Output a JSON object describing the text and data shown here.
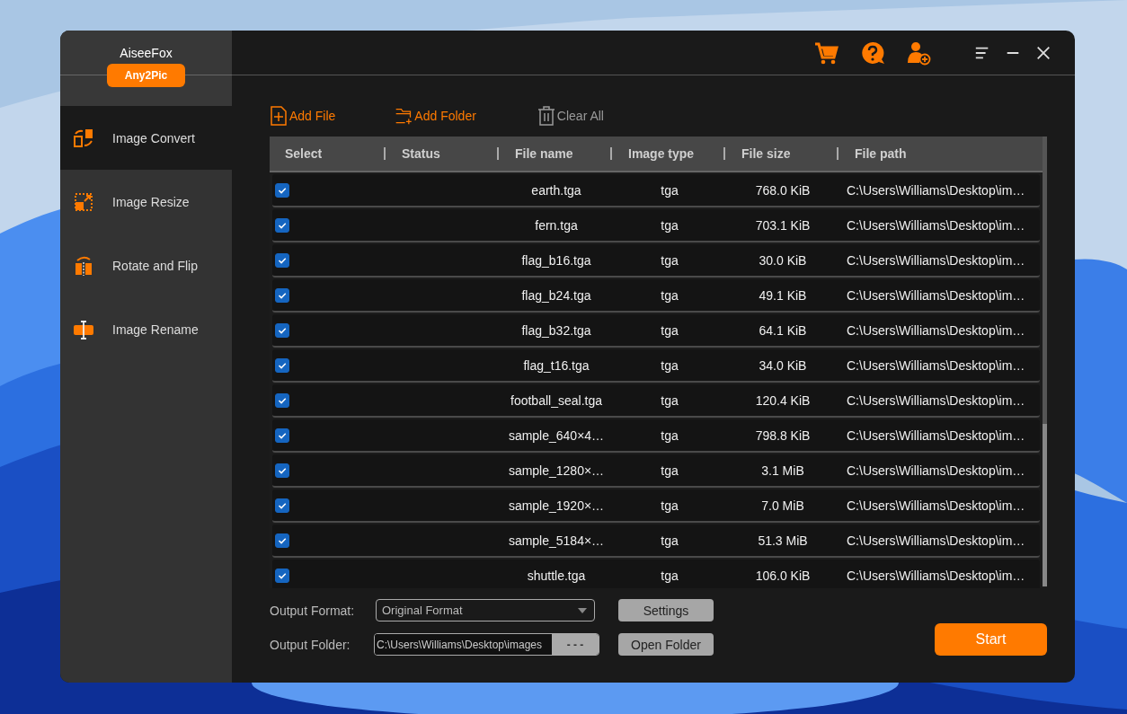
{
  "app": {
    "brand": "AiseeFox",
    "product": "Any2Pic"
  },
  "sidebar": {
    "items": [
      {
        "label": "Image Convert",
        "kind": "convert",
        "selected": true
      },
      {
        "label": "Image Resize",
        "kind": "resize",
        "selected": false
      },
      {
        "label": "Rotate and Flip",
        "kind": "rotate",
        "selected": false
      },
      {
        "label": "Image Rename",
        "kind": "rename",
        "selected": false
      }
    ]
  },
  "toolbar": [
    {
      "label": "Add File",
      "kind": "file",
      "disabled": false
    },
    {
      "label": "Add Folder",
      "kind": "folder",
      "disabled": false
    },
    {
      "label": "Clear All",
      "kind": "clear",
      "disabled": true
    }
  ],
  "table": {
    "columns": [
      "Select",
      "Status",
      "File name",
      "Image type",
      "File size",
      "File path"
    ],
    "rows": [
      {
        "checked": true,
        "file_name": "earth.tga",
        "image_type": "tga",
        "file_size": "768.0 KiB",
        "file_path": "C:\\Users\\Williams\\Desktop\\im…"
      },
      {
        "checked": true,
        "file_name": "fern.tga",
        "image_type": "tga",
        "file_size": "703.1 KiB",
        "file_path": "C:\\Users\\Williams\\Desktop\\im…"
      },
      {
        "checked": true,
        "file_name": "flag_b16.tga",
        "image_type": "tga",
        "file_size": "30.0 KiB",
        "file_path": "C:\\Users\\Williams\\Desktop\\im…"
      },
      {
        "checked": true,
        "file_name": "flag_b24.tga",
        "image_type": "tga",
        "file_size": "49.1 KiB",
        "file_path": "C:\\Users\\Williams\\Desktop\\im…"
      },
      {
        "checked": true,
        "file_name": "flag_b32.tga",
        "image_type": "tga",
        "file_size": "64.1 KiB",
        "file_path": "C:\\Users\\Williams\\Desktop\\im…"
      },
      {
        "checked": true,
        "file_name": "flag_t16.tga",
        "image_type": "tga",
        "file_size": "34.0 KiB",
        "file_path": "C:\\Users\\Williams\\Desktop\\im…"
      },
      {
        "checked": true,
        "file_name": "football_seal.tga",
        "image_type": "tga",
        "file_size": "120.4 KiB",
        "file_path": "C:\\Users\\Williams\\Desktop\\im…"
      },
      {
        "checked": true,
        "file_name": "sample_640×4…",
        "image_type": "tga",
        "file_size": "798.8 KiB",
        "file_path": "C:\\Users\\Williams\\Desktop\\im…"
      },
      {
        "checked": true,
        "file_name": "sample_1280×…",
        "image_type": "tga",
        "file_size": "3.1 MiB",
        "file_path": "C:\\Users\\Williams\\Desktop\\im…"
      },
      {
        "checked": true,
        "file_name": "sample_1920×…",
        "image_type": "tga",
        "file_size": "7.0 MiB",
        "file_path": "C:\\Users\\Williams\\Desktop\\im…"
      },
      {
        "checked": true,
        "file_name": "sample_5184×…",
        "image_type": "tga",
        "file_size": "51.3 MiB",
        "file_path": "C:\\Users\\Williams\\Desktop\\im…"
      },
      {
        "checked": true,
        "file_name": "shuttle.tga",
        "image_type": "tga",
        "file_size": "106.0 KiB",
        "file_path": "C:\\Users\\Williams\\Desktop\\im…"
      }
    ]
  },
  "output": {
    "format_label": "Output Format:",
    "format_value": "Original Format",
    "settings_button": "Settings",
    "folder_label": "Output Folder:",
    "folder_value": "C:\\Users\\Williams\\Desktop\\images",
    "browse_button": "- - -",
    "open_folder_button": "Open Folder",
    "start_button": "Start"
  }
}
